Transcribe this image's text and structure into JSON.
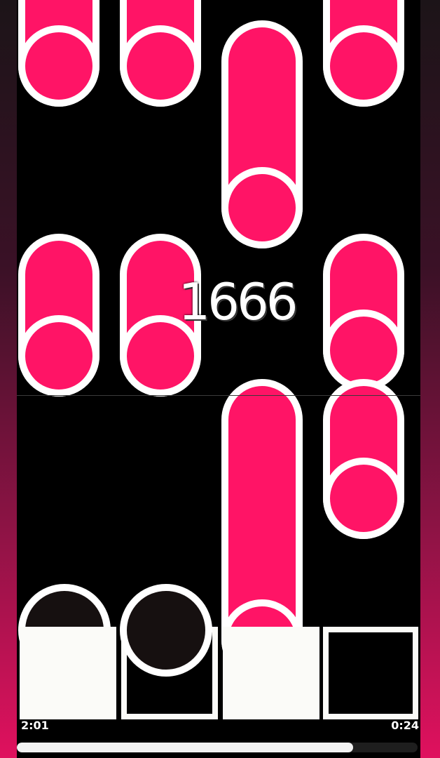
{
  "score": "1666",
  "time_elapsed": "2:01",
  "time_remaining": "0:24",
  "song_progress": 0.84,
  "colors": {
    "note": "#ff1466",
    "note_outline": "#ffffff",
    "receptor": "#fbfbf8",
    "lane_background": "#000000"
  }
}
